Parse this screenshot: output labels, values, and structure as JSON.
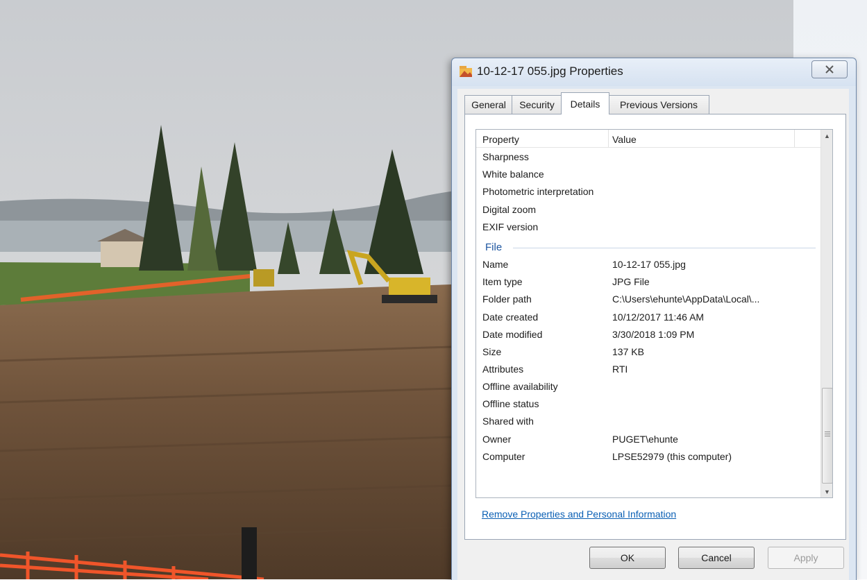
{
  "window": {
    "title": "10-12-17 055.jpg Properties",
    "close_glyph": "X",
    "icon": "image-file-icon"
  },
  "tabs": [
    {
      "label": "General"
    },
    {
      "label": "Security"
    },
    {
      "label": "Details"
    },
    {
      "label": "Previous Versions"
    }
  ],
  "active_tab": "Details",
  "details": {
    "header": {
      "property": "Property",
      "value": "Value"
    },
    "rows_top": [
      {
        "property": "Sharpness",
        "value": ""
      },
      {
        "property": "White balance",
        "value": ""
      },
      {
        "property": "Photometric interpretation",
        "value": ""
      },
      {
        "property": "Digital zoom",
        "value": ""
      },
      {
        "property": "EXIF version",
        "value": ""
      }
    ],
    "group_label": "File",
    "rows_file": [
      {
        "property": "Name",
        "value": "10-12-17 055.jpg"
      },
      {
        "property": "Item type",
        "value": "JPG File"
      },
      {
        "property": "Folder path",
        "value": "C:\\Users\\ehunte\\AppData\\Local\\..."
      },
      {
        "property": "Date created",
        "value": "10/12/2017 11:46 AM"
      },
      {
        "property": "Date modified",
        "value": "3/30/2018 1:09 PM"
      },
      {
        "property": "Size",
        "value": "137 KB"
      },
      {
        "property": "Attributes",
        "value": "RTI"
      },
      {
        "property": "Offline availability",
        "value": ""
      },
      {
        "property": "Offline status",
        "value": ""
      },
      {
        "property": "Shared with",
        "value": ""
      },
      {
        "property": "Owner",
        "value": "PUGET\\ehunte"
      },
      {
        "property": "Computer",
        "value": "LPSE52979 (this computer)"
      }
    ]
  },
  "remove_link": "Remove Properties and Personal Information",
  "buttons": {
    "ok": "OK",
    "cancel": "Cancel",
    "apply": "Apply"
  },
  "colors": {
    "link": "#0a5fb4",
    "group": "#1e56a0"
  }
}
